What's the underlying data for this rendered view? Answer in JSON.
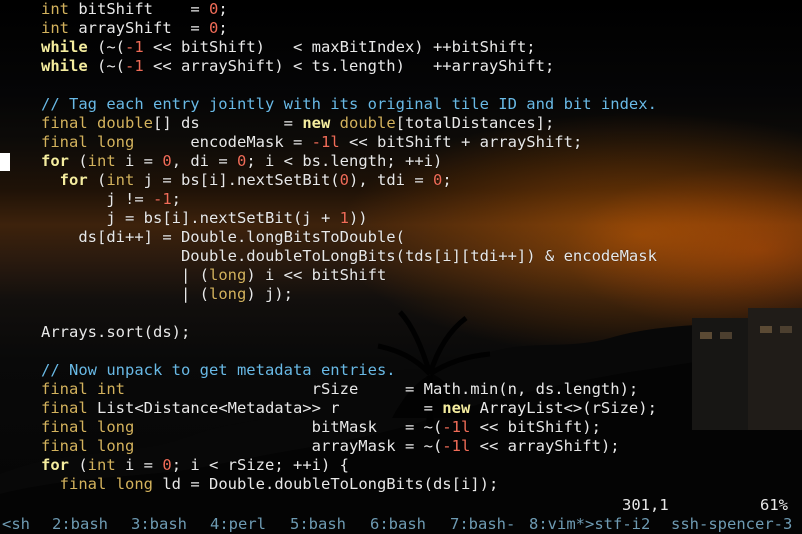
{
  "colors": {
    "keyword": "#f5ed9f",
    "type": "#d3b25d",
    "comment": "#69b9e5",
    "number": "#f06c58",
    "text": "#e8e8e8",
    "status": "#6e9bb3",
    "cursor": "#ffffff"
  },
  "editor": {
    "lines": [
      {
        "tokens": [
          {
            "t": "int",
            "c": "tp"
          },
          {
            "t": " bitShift    = "
          },
          {
            "t": "0",
            "c": "nm"
          },
          {
            "t": ";"
          }
        ]
      },
      {
        "tokens": [
          {
            "t": "int",
            "c": "tp"
          },
          {
            "t": " arrayShift  = "
          },
          {
            "t": "0",
            "c": "nm"
          },
          {
            "t": ";"
          }
        ]
      },
      {
        "tokens": [
          {
            "t": "while",
            "c": "kw"
          },
          {
            "t": " (~("
          },
          {
            "t": "-1",
            "c": "nm"
          },
          {
            "t": " << bitShift)   < maxBitIndex) ++bitShift;"
          }
        ]
      },
      {
        "tokens": [
          {
            "t": "while",
            "c": "kw"
          },
          {
            "t": " (~("
          },
          {
            "t": "-1",
            "c": "nm"
          },
          {
            "t": " << arrayShift) < ts.length)   ++arrayShift;"
          }
        ]
      },
      {
        "tokens": []
      },
      {
        "tokens": [
          {
            "t": "// Tag each entry jointly with its original tile ID and bit index.",
            "c": "cm"
          }
        ]
      },
      {
        "tokens": [
          {
            "t": "final",
            "c": "tp"
          },
          {
            "t": " "
          },
          {
            "t": "double",
            "c": "tp"
          },
          {
            "t": "[] ds         = "
          },
          {
            "t": "new",
            "c": "kw"
          },
          {
            "t": " "
          },
          {
            "t": "double",
            "c": "tp"
          },
          {
            "t": "[totalDistances];"
          }
        ]
      },
      {
        "tokens": [
          {
            "t": "final",
            "c": "tp"
          },
          {
            "t": " "
          },
          {
            "t": "long",
            "c": "tp"
          },
          {
            "t": "      encodeMask = "
          },
          {
            "t": "-1l",
            "c": "nm"
          },
          {
            "t": " << bitShift + arrayShift;"
          }
        ]
      },
      {
        "tokens": [
          {
            "t": "for",
            "c": "kw"
          },
          {
            "t": " ("
          },
          {
            "t": "int",
            "c": "tp"
          },
          {
            "t": " i = "
          },
          {
            "t": "0",
            "c": "nm"
          },
          {
            "t": ", di = "
          },
          {
            "t": "0",
            "c": "nm"
          },
          {
            "t": "; i < bs.length; ++i)"
          }
        ]
      },
      {
        "tokens": [
          {
            "t": "  "
          },
          {
            "t": "for",
            "c": "kw"
          },
          {
            "t": " ("
          },
          {
            "t": "int",
            "c": "tp"
          },
          {
            "t": " j = bs[i].nextSetBit("
          },
          {
            "t": "0",
            "c": "nm"
          },
          {
            "t": "), tdi = "
          },
          {
            "t": "0",
            "c": "nm"
          },
          {
            "t": ";"
          }
        ]
      },
      {
        "tokens": [
          {
            "t": "       j != "
          },
          {
            "t": "-1",
            "c": "nm"
          },
          {
            "t": ";"
          }
        ]
      },
      {
        "tokens": [
          {
            "t": "       j = bs[i].nextSetBit(j + "
          },
          {
            "t": "1",
            "c": "nm"
          },
          {
            "t": "))"
          }
        ]
      },
      {
        "tokens": [
          {
            "t": "    ds[di++] = Double.longBitsToDouble("
          }
        ]
      },
      {
        "tokens": [
          {
            "t": "               Double.doubleToLongBits(tds[i][tdi++]) & encodeMask"
          }
        ]
      },
      {
        "tokens": [
          {
            "t": "               | ("
          },
          {
            "t": "long",
            "c": "tp"
          },
          {
            "t": ") i << bitShift"
          }
        ]
      },
      {
        "tokens": [
          {
            "t": "               | ("
          },
          {
            "t": "long",
            "c": "tp"
          },
          {
            "t": ") j);"
          }
        ]
      },
      {
        "tokens": []
      },
      {
        "tokens": [
          {
            "t": "Arrays.sort(ds);"
          }
        ]
      },
      {
        "tokens": []
      },
      {
        "tokens": [
          {
            "t": "// Now unpack to get metadata entries.",
            "c": "cm"
          }
        ]
      },
      {
        "tokens": [
          {
            "t": "final",
            "c": "tp"
          },
          {
            "t": " "
          },
          {
            "t": "int",
            "c": "tp"
          },
          {
            "t": "                    rSize     = Math.min(n, ds.length);"
          }
        ]
      },
      {
        "tokens": [
          {
            "t": "final",
            "c": "tp"
          },
          {
            "t": " List<Distance<Metadata>> r         = "
          },
          {
            "t": "new",
            "c": "kw"
          },
          {
            "t": " ArrayList<>(rSize);"
          }
        ]
      },
      {
        "tokens": [
          {
            "t": "final",
            "c": "tp"
          },
          {
            "t": " "
          },
          {
            "t": "long",
            "c": "tp"
          },
          {
            "t": "                   bitMask   = ~("
          },
          {
            "t": "-1l",
            "c": "nm"
          },
          {
            "t": " << bitShift);"
          }
        ]
      },
      {
        "tokens": [
          {
            "t": "final",
            "c": "tp"
          },
          {
            "t": " "
          },
          {
            "t": "long",
            "c": "tp"
          },
          {
            "t": "                   arrayMask = ~("
          },
          {
            "t": "-1l",
            "c": "nm"
          },
          {
            "t": " << arrayShift);"
          }
        ]
      },
      {
        "tokens": [
          {
            "t": "for",
            "c": "kw"
          },
          {
            "t": " ("
          },
          {
            "t": "int",
            "c": "tp"
          },
          {
            "t": " i = "
          },
          {
            "t": "0",
            "c": "nm"
          },
          {
            "t": "; i < rSize; ++i) {"
          }
        ]
      },
      {
        "tokens": [
          {
            "t": "  "
          },
          {
            "t": "final",
            "c": "tp"
          },
          {
            "t": " "
          },
          {
            "t": "long",
            "c": "tp"
          },
          {
            "t": " ld = Double.doubleToLongBits(ds[i]);"
          }
        ]
      }
    ]
  },
  "ruler": {
    "position": "301,1",
    "percent": "61%"
  },
  "statusbar": {
    "windows": [
      "<sh",
      "2:bash",
      "3:bash",
      "4:perl",
      "5:bash",
      "6:bash",
      "7:bash-",
      "8:vim*>stf-i2",
      "ssh-spencer-3"
    ]
  }
}
